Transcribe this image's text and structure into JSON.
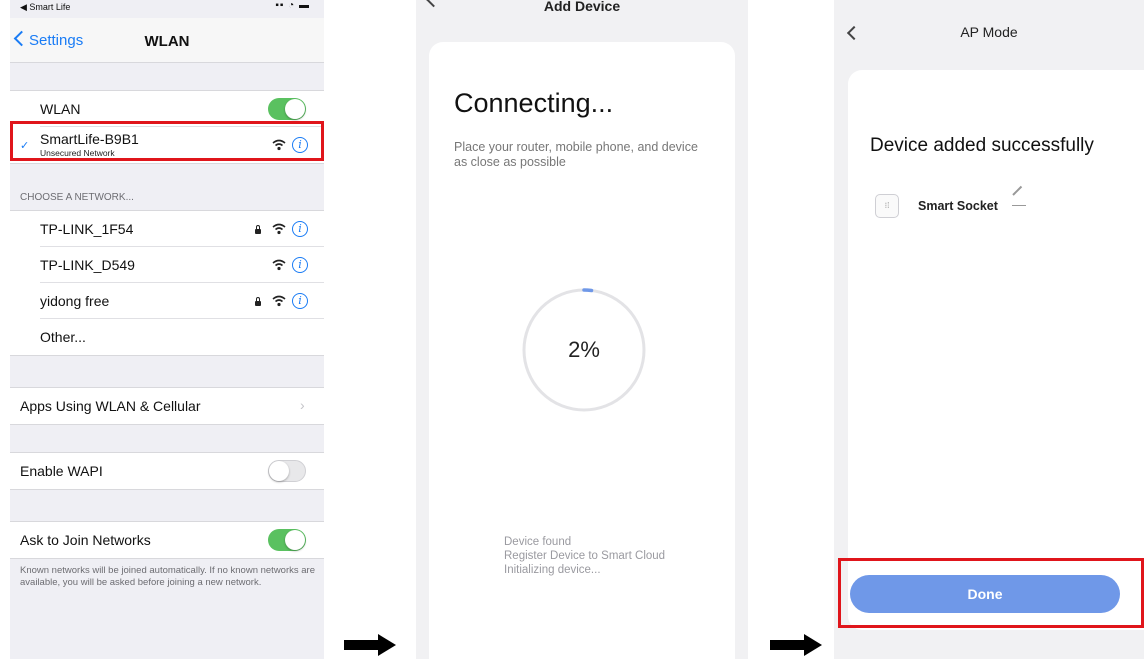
{
  "colors": {
    "ios_blue": "#1a7cf5",
    "toggle_on": "#5ac160",
    "highlight_red": "#e0151b",
    "done_button": "#6f98e8",
    "progress_arc": "#6f98e8"
  },
  "panel1": {
    "status_back_app": "◀ Smart Life",
    "nav_back_label": "Settings",
    "nav_title": "WLAN",
    "wlan_label": "WLAN",
    "wlan_toggle_on": true,
    "connected_network": {
      "name": "SmartLife-B9B1",
      "subtitle": "Unsecured Network",
      "icons": [
        "checkmark-icon",
        "wifi-icon",
        "info-icon"
      ]
    },
    "choose_header": "CHOOSE A NETWORK...",
    "networks": [
      {
        "name": "TP-LINK_1F54",
        "locked": true
      },
      {
        "name": "TP-LINK_D549",
        "locked": false
      },
      {
        "name": "yidong free",
        "locked": true
      }
    ],
    "other_label": "Other...",
    "apps_label": "Apps Using WLAN & Cellular",
    "wapi_label": "Enable WAPI",
    "wapi_toggle_on": false,
    "ask_label": "Ask to Join Networks",
    "ask_toggle_on": true,
    "footnote": "Known networks will be joined automatically. If no known networks are available, you will be asked before joining a new network."
  },
  "panel2": {
    "title": "Add Device",
    "heading": "Connecting...",
    "subtitle": "Place your router, mobile phone, and device as close as possible",
    "progress_percent": 2,
    "progress_label": "2%",
    "steps": [
      "Device found",
      "Register Device to Smart Cloud",
      "Initializing device..."
    ]
  },
  "panel3": {
    "title": "AP Mode",
    "heading": "Device added successfully",
    "device_name": "Smart Socket",
    "done_label": "Done"
  }
}
